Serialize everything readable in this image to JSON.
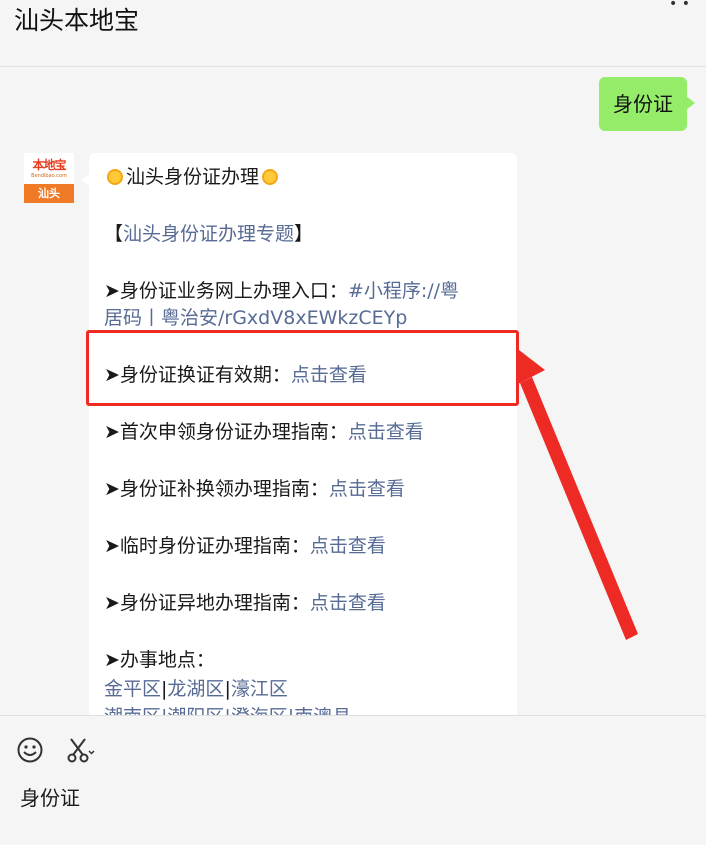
{
  "window": {
    "title": "汕头本地宝"
  },
  "messages": {
    "outgoing": {
      "text": "身份证"
    },
    "avatar": {
      "brand": "本地宝",
      "brand_sub": "Bendibao.com",
      "city": "汕头"
    },
    "reply": {
      "heading": "汕头身份证办理",
      "topic": {
        "open": "【",
        "link": "汕头身份证办理专题",
        "close": "】"
      },
      "entry": {
        "prefix": "➤身份证业务网上办理入口：",
        "link_part1": "#小程序://粤",
        "link_part2": "居码丨粤治安/rGxdV8xEWkzCEYp"
      },
      "items": [
        {
          "label": "➤身份证换证有效期：",
          "link": "点击查看"
        },
        {
          "label": "➤首次申领身份证办理指南：",
          "link": "点击查看"
        },
        {
          "label": "➤身份证补换领办理指南：",
          "link": "点击查看"
        },
        {
          "label": "➤临时身份证办理指南：",
          "link": "点击查看"
        },
        {
          "label": "➤身份证异地办理指南：",
          "link": "点击查看"
        }
      ],
      "locations": {
        "label": "➤办事地点：",
        "districts": [
          "金平区",
          "龙湖区",
          "濠江区"
        ],
        "separator": "|",
        "clipped_line": "潮南区|潮阳区|澄海区|南澳县"
      }
    }
  },
  "input": {
    "emoji_icon": "smile-icon",
    "scissors_icon": "scissors-icon",
    "value": "身份证"
  },
  "colors": {
    "link": "#576b95",
    "outgoing_bubble": "#95ec69",
    "highlight": "#ee2a24"
  }
}
